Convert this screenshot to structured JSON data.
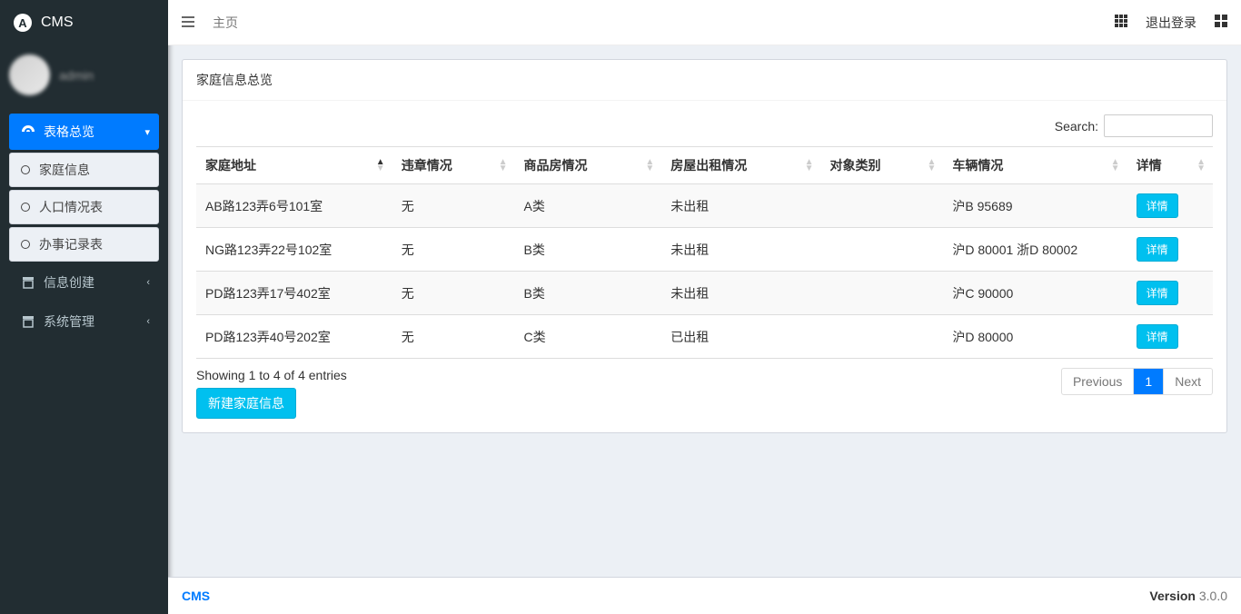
{
  "brand": {
    "name": "CMS"
  },
  "user": {
    "name": "admin"
  },
  "sidebar": {
    "items": [
      {
        "label": "表格总览",
        "icon": "dashboard",
        "active": true,
        "expandable": true
      },
      {
        "label": "信息创建",
        "icon": "archive",
        "expandable": true
      },
      {
        "label": "系统管理",
        "icon": "archive",
        "expandable": true
      }
    ],
    "submenu": [
      {
        "label": "家庭信息"
      },
      {
        "label": "人口情况表"
      },
      {
        "label": "办事记录表"
      }
    ]
  },
  "topbar": {
    "breadcrumb": "主页",
    "logout": "退出登录"
  },
  "panel": {
    "title": "家庭信息总览",
    "search_label": "Search:",
    "columns": [
      "家庭地址",
      "违章情况",
      "商品房情况",
      "房屋出租情况",
      "对象类别",
      "车辆情况",
      "详情"
    ],
    "rows": [
      {
        "address": "AB路123弄6号101室",
        "violation": "无",
        "housing": "A类",
        "rent": "未出租",
        "category": "",
        "vehicle": "沪B 95689",
        "action": "详情"
      },
      {
        "address": "NG路123弄22号102室",
        "violation": "无",
        "housing": "B类",
        "rent": "未出租",
        "category": "",
        "vehicle": "沪D 80001 浙D 80002",
        "action": "详情"
      },
      {
        "address": "PD路123弄17号402室",
        "violation": "无",
        "housing": "B类",
        "rent": "未出租",
        "category": "",
        "vehicle": "沪C 90000",
        "action": "详情"
      },
      {
        "address": "PD路123弄40号202室",
        "violation": "无",
        "housing": "C类",
        "rent": "已出租",
        "category": "",
        "vehicle": "沪D 80000",
        "action": "详情"
      }
    ],
    "info": "Showing 1 to 4 of 4 entries",
    "new_button": "新建家庭信息",
    "pagination": {
      "prev": "Previous",
      "page": "1",
      "next": "Next"
    }
  },
  "footer": {
    "brand": "CMS",
    "version_label": "Version",
    "version": "3.0.0"
  }
}
